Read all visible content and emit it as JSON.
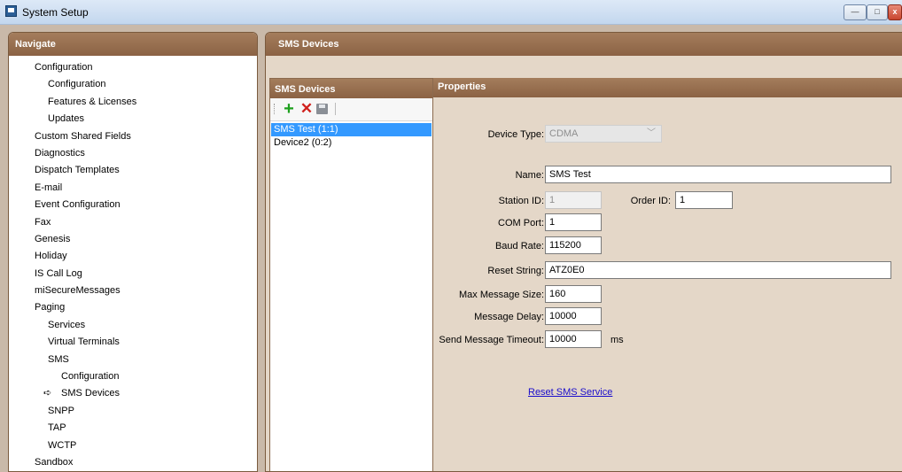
{
  "window": {
    "title": "System Setup",
    "min": "—",
    "max": "□",
    "close": "x"
  },
  "navigate": {
    "header": "Navigate",
    "items": [
      {
        "label": "Configuration",
        "level": 0
      },
      {
        "label": "Configuration",
        "level": 1
      },
      {
        "label": "Features & Licenses",
        "level": 1
      },
      {
        "label": "Updates",
        "level": 1
      },
      {
        "label": "Custom Shared Fields",
        "level": 0
      },
      {
        "label": "Diagnostics",
        "level": 0
      },
      {
        "label": "Dispatch Templates",
        "level": 0
      },
      {
        "label": "E-mail",
        "level": 0
      },
      {
        "label": "Event Configuration",
        "level": 0
      },
      {
        "label": "Fax",
        "level": 0
      },
      {
        "label": "Genesis",
        "level": 0
      },
      {
        "label": "Holiday",
        "level": 0
      },
      {
        "label": "IS Call Log",
        "level": 0
      },
      {
        "label": "miSecureMessages",
        "level": 0
      },
      {
        "label": "Paging",
        "level": 0
      },
      {
        "label": "Services",
        "level": 1
      },
      {
        "label": "Virtual Terminals",
        "level": 1
      },
      {
        "label": "SMS",
        "level": 1
      },
      {
        "label": "Configuration",
        "level": 2
      },
      {
        "label": "SMS Devices",
        "level": 2,
        "selected": true
      },
      {
        "label": "SNPP",
        "level": 1
      },
      {
        "label": "TAP",
        "level": 1
      },
      {
        "label": "WCTP",
        "level": 1
      },
      {
        "label": "Sandbox",
        "level": 0
      }
    ]
  },
  "main": {
    "header": "SMS Devices",
    "list": {
      "header": "SMS Devices",
      "toolbar": {
        "add": "+",
        "delete": "✕"
      },
      "items": [
        {
          "label": "SMS Test (1:1)",
          "selected": true
        },
        {
          "label": "Device2 (0:2)",
          "selected": false
        }
      ]
    },
    "properties": {
      "header": "Properties",
      "device_type_label": "Device Type:",
      "device_type_value": "CDMA",
      "name_label": "Name:",
      "name_value": "SMS Test",
      "station_id_label": "Station ID:",
      "station_id_value": "1",
      "order_id_label": "Order ID:",
      "order_id_value": "1",
      "com_port_label": "COM Port:",
      "com_port_value": "1",
      "baud_rate_label": "Baud Rate:",
      "baud_rate_value": "115200",
      "reset_string_label": "Reset String:",
      "reset_string_value": "ATZ0E0",
      "max_msg_size_label": "Max Message Size:",
      "max_msg_size_value": "160",
      "msg_delay_label": "Message Delay:",
      "msg_delay_value": "10000",
      "send_timeout_label": "Send Message Timeout:",
      "send_timeout_value": "10000",
      "send_timeout_unit": "ms",
      "reset_link": "Reset SMS Service"
    }
  }
}
